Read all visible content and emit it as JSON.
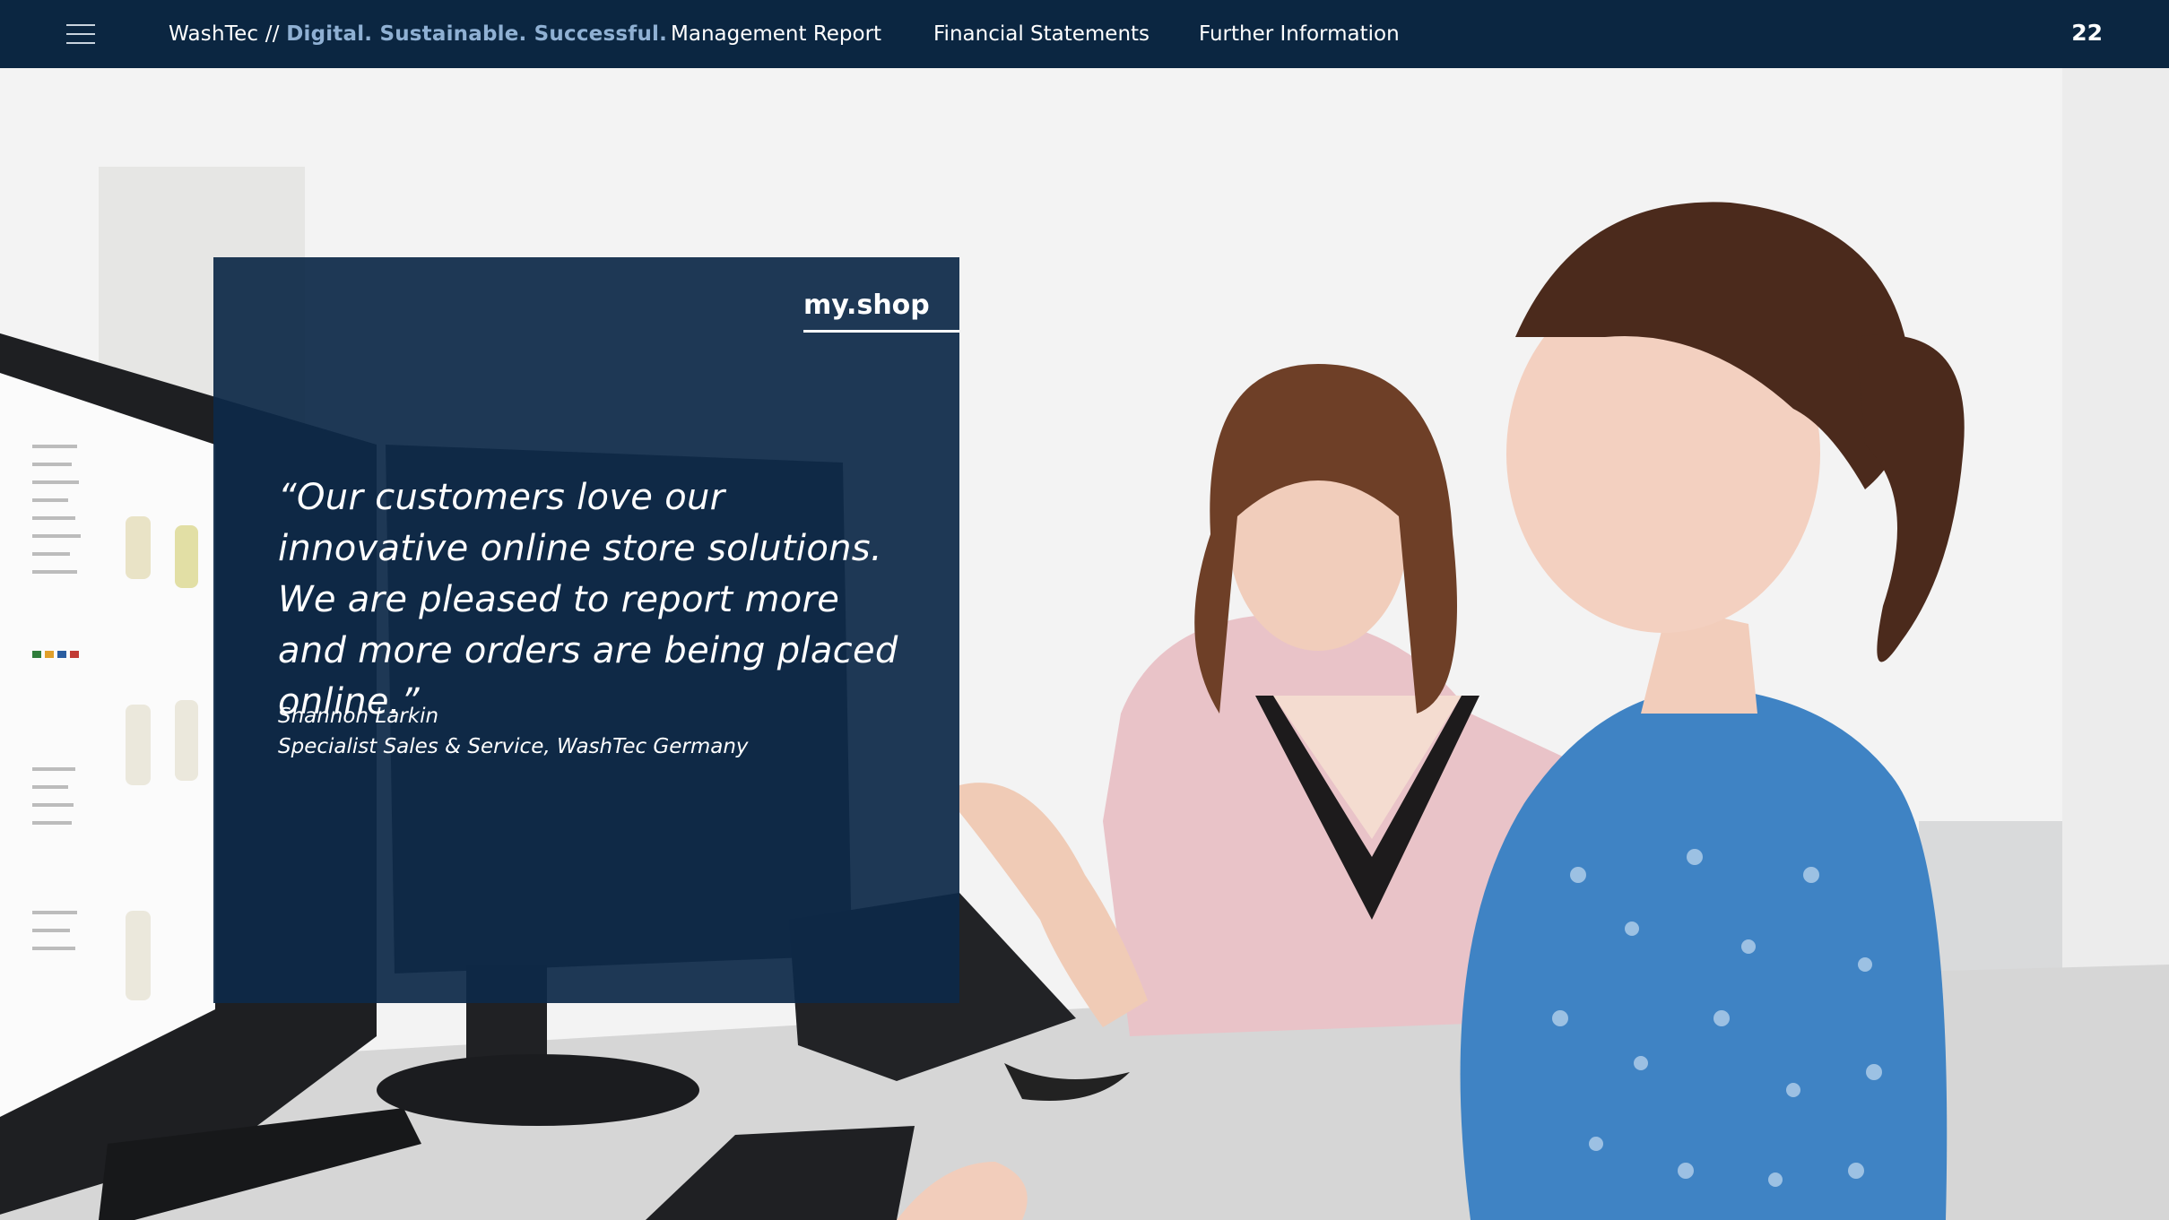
{
  "header": {
    "menu_icon": "hamburger-menu-icon",
    "brand_name": "WashTec //",
    "brand_tagline": "Digital. Sustainable. Successful.",
    "nav": [
      {
        "label": "Management Report"
      },
      {
        "label": "Financial Statements"
      },
      {
        "label": "Further Information"
      }
    ],
    "page_number": "22"
  },
  "card": {
    "tag": "my.shop",
    "quote": "“Our customers love our innovative online store solutions. We are pleased to report more and more orders are being placed online.”",
    "author_name": "Shannon Larkin",
    "author_title": "Specialist Sales & Service, WashTec Germany"
  },
  "colors": {
    "nav_background": "#0b2641",
    "tagline": "#8fb0d3",
    "card_background": "#0d2948"
  }
}
